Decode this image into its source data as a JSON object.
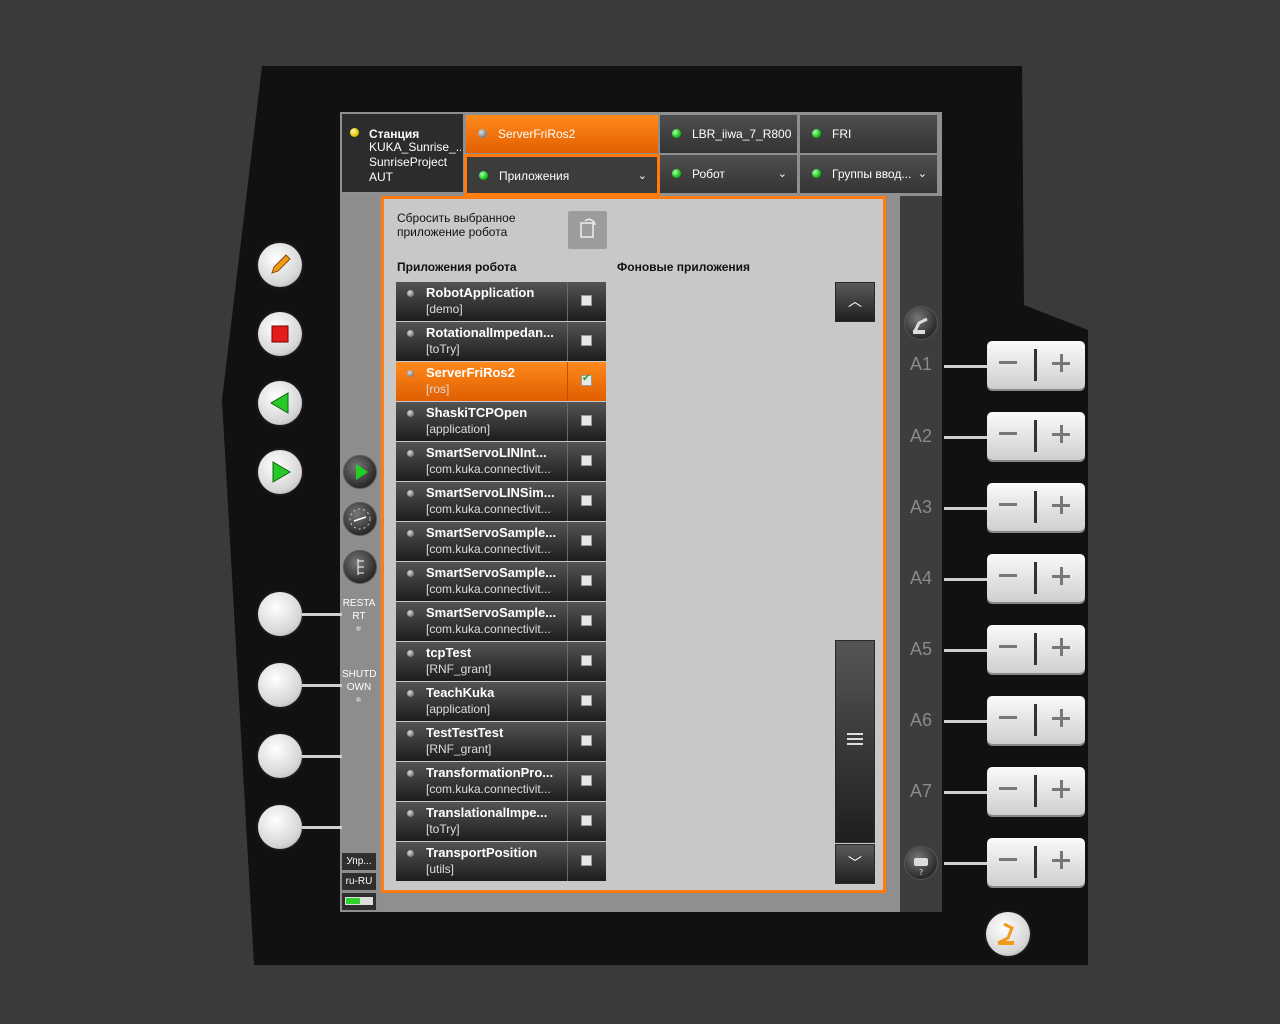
{
  "header": {
    "station": {
      "title": "Станция",
      "line1": "KUKA_Sunrise_...",
      "line2": "SunriseProject",
      "line3": "AUT",
      "status": "yellow"
    },
    "tabs": [
      {
        "label": "ServerFriRos2",
        "status": "gray",
        "active": true
      },
      {
        "label": "LBR_iiwa_7_R800",
        "status": "green"
      },
      {
        "label": "FRI",
        "status": "green"
      }
    ],
    "subtabs": [
      {
        "label": "Приложения",
        "status": "green",
        "selected": true
      },
      {
        "label": "Робот",
        "status": "green"
      },
      {
        "label": "Группы ввод...",
        "status": "green"
      }
    ]
  },
  "sidebar": {
    "restart_label": "RESTA RT",
    "shutdown_label": "SHUTD OWN",
    "user_btn": "Упр...",
    "lang_btn": "ru-RU"
  },
  "popup": {
    "reset_text": "Сбросить выбранное приложение робота",
    "robot_apps_header": "Приложения робота",
    "background_apps_header": "Фоновые приложения",
    "apps": [
      {
        "name": "RobotApplication",
        "pkg": "[demo]",
        "checked": false,
        "selected": false
      },
      {
        "name": "RotationalImpedan...",
        "pkg": "[toTry]",
        "checked": false,
        "selected": false
      },
      {
        "name": "ServerFriRos2",
        "pkg": "[ros]",
        "checked": true,
        "selected": true
      },
      {
        "name": "ShaskiTCPOpen",
        "pkg": "[application]",
        "checked": false,
        "selected": false
      },
      {
        "name": "SmartServoLINInt...",
        "pkg": "[com.kuka.connectivit...",
        "checked": false,
        "selected": false
      },
      {
        "name": "SmartServoLINSim...",
        "pkg": "[com.kuka.connectivit...",
        "checked": false,
        "selected": false
      },
      {
        "name": "SmartServoSample...",
        "pkg": "[com.kuka.connectivit...",
        "checked": false,
        "selected": false
      },
      {
        "name": "SmartServoSample...",
        "pkg": "[com.kuka.connectivit...",
        "checked": false,
        "selected": false
      },
      {
        "name": "SmartServoSample...",
        "pkg": "[com.kuka.connectivit...",
        "checked": false,
        "selected": false
      },
      {
        "name": "tcpTest",
        "pkg": "[RNF_grant]",
        "checked": false,
        "selected": false
      },
      {
        "name": "TeachKuka",
        "pkg": "[application]",
        "checked": false,
        "selected": false
      },
      {
        "name": "TestTestTest",
        "pkg": "[RNF_grant]",
        "checked": false,
        "selected": false
      },
      {
        "name": "TransformationPro...",
        "pkg": "[com.kuka.connectivit...",
        "checked": false,
        "selected": false
      },
      {
        "name": "TranslationalImpe...",
        "pkg": "[toTry]",
        "checked": false,
        "selected": false
      },
      {
        "name": "TransportPosition",
        "pkg": "[utils]",
        "checked": false,
        "selected": false
      }
    ]
  },
  "axes": [
    "A1",
    "A2",
    "A3",
    "A4",
    "A5",
    "A6",
    "A7"
  ],
  "icons": {
    "edit": "pencil-icon",
    "stop": "stop-icon",
    "back": "play-backward-icon",
    "start": "play-icon"
  }
}
